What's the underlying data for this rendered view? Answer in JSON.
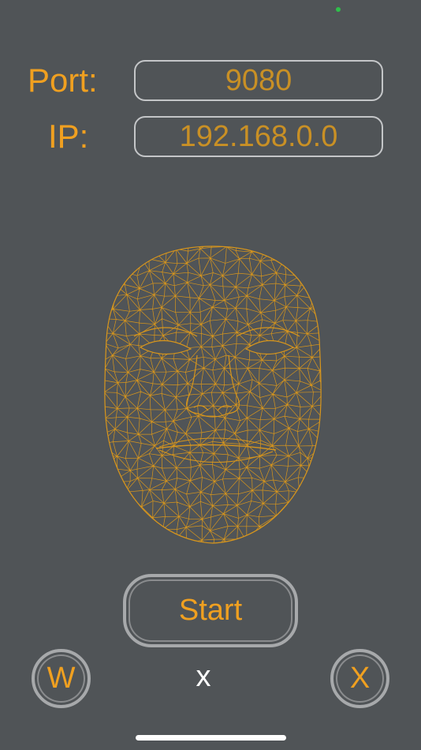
{
  "colors": {
    "background": "#505457",
    "accent": "#f0a020",
    "field_text": "#c99025",
    "border": "#c4c6c8",
    "status_dot": "#2fbf4a"
  },
  "connection": {
    "port_label": "Port:",
    "port_value": "9080",
    "ip_label": "IP:",
    "ip_value": "192.168.0.0"
  },
  "face_mesh": {
    "icon": "face-wireframe-mesh",
    "color": "#d8961c"
  },
  "controls": {
    "start_label": "Start",
    "left_button_label": "W",
    "middle_text": "x",
    "right_button_label": "X"
  }
}
